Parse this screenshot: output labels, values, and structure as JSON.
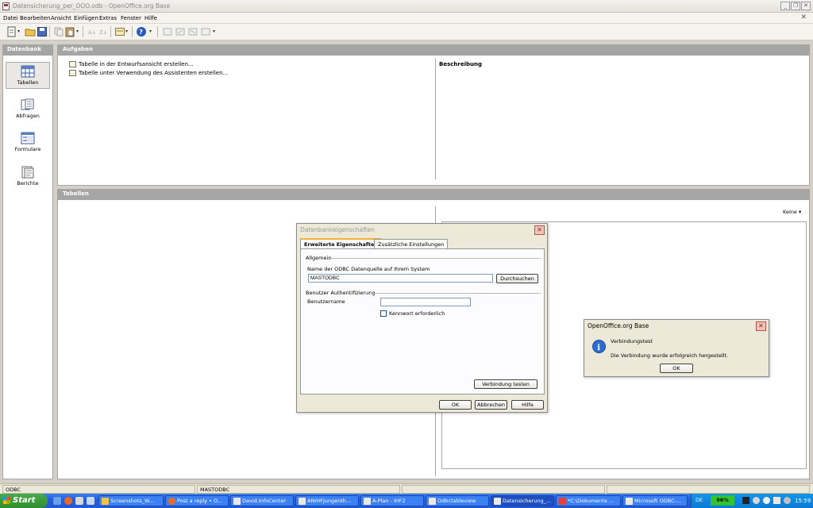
{
  "window": {
    "title": "Datensicherung_per_OOO.odb - OpenOffice.org Base"
  },
  "menu": [
    "Datei",
    "Bearbeiten",
    "Ansicht",
    "Einfügen",
    "Extras",
    "Fenster",
    "Hilfe"
  ],
  "sidebar": {
    "header": "Datenbank",
    "items": [
      {
        "label": "Tabellen",
        "icon": "table-icon",
        "selected": true
      },
      {
        "label": "Abfragen",
        "icon": "query-icon",
        "selected": false
      },
      {
        "label": "Formulare",
        "icon": "form-icon",
        "selected": false
      },
      {
        "label": "Berichte",
        "icon": "report-icon",
        "selected": false
      }
    ]
  },
  "tasks": {
    "header": "Aufgaben",
    "items": [
      "Tabelle in der Entwurfsansicht erstellen...",
      "Tabelle unter Verwendung des Assistenten erstellen..."
    ],
    "description_label": "Beschreibung"
  },
  "tables": {
    "header": "Tabellen",
    "preview_select": "Keine"
  },
  "db_dialog": {
    "title": "Datenbankeigenschaften",
    "tabs": [
      "Erweiterte Eigenschaften",
      "Zusätzliche Einstellungen"
    ],
    "section_general": "Allgemein",
    "odbc_label": "Name der ODBC Datenquelle auf Ihrem System",
    "odbc_value": "MASTODBC",
    "browse_button": "Durchsuchen",
    "section_auth": "Benutzer Authentifizierung",
    "username_label": "Benutzername",
    "username_value": "",
    "password_required_label": "Kennwort erforderlich",
    "test_button": "Verbindung testen",
    "ok_button": "OK",
    "cancel_button": "Abbrechen",
    "help_button": "Hilfe"
  },
  "msg_dialog": {
    "title": "OpenOffice.org Base",
    "heading": "Verbindungstest",
    "message": "Die Verbindung wurde erfolgreich hergestellt.",
    "ok_button": "OK"
  },
  "statusbar": {
    "left": "ODBC",
    "right": "MASTODBC"
  },
  "taskbar": {
    "start": "Start",
    "tasks": [
      "Screenshots_W...",
      "Post a reply • O...",
      "David.InfoCenter",
      "ANIHFJungenth...",
      "A-Plan - IHF2",
      "Odbctableview",
      "Datensicherung_...",
      "*C:\\Dokumente ...",
      "Microsoft ODBC-..."
    ],
    "language": "DE",
    "battery": "96%",
    "clock": "15:59"
  }
}
